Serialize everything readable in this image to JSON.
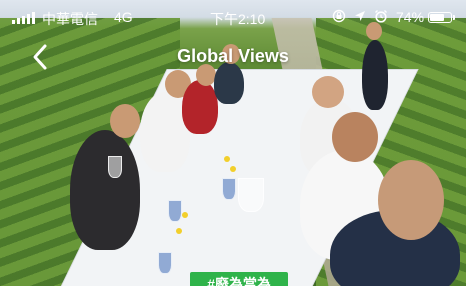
{
  "status_bar": {
    "carrier": "中華電信",
    "network": "4G",
    "time": "下午2:10",
    "battery_percent": "74%",
    "battery_level": 0.74,
    "icons": [
      "lock-rotation-icon",
      "location-arrow-icon",
      "alarm-icon"
    ]
  },
  "nav": {
    "title": "Global Views",
    "back_icon": "chevron-left-icon"
  },
  "photo": {
    "subject": "group-dining-photo"
  },
  "tag": {
    "label": "#廢為當為"
  }
}
